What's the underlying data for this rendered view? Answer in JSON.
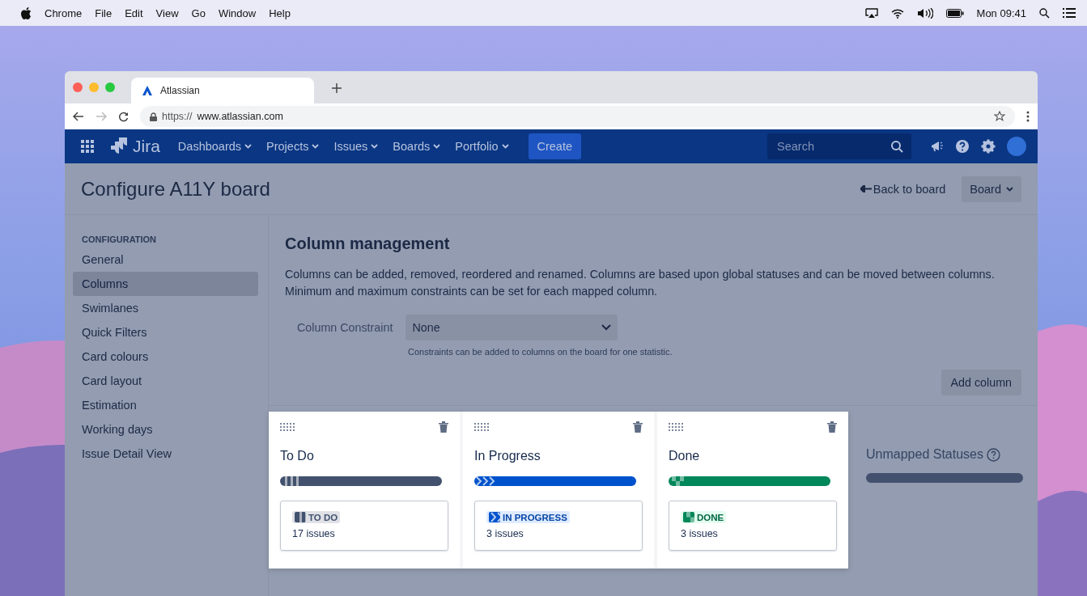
{
  "menubar": {
    "app": "Chrome",
    "menus": [
      "File",
      "Edit",
      "View",
      "Go",
      "Window",
      "Help"
    ],
    "clock": "Mon 09:41"
  },
  "browser": {
    "tab": "Atlassian",
    "url_scheme": "https://",
    "url_host": "www.atlassian.com"
  },
  "nav": {
    "product": "Jira",
    "menus": [
      "Dashboards",
      "Projects",
      "Issues",
      "Boards",
      "Portfolio"
    ],
    "create": "Create",
    "search": {
      "placeholder": "Search"
    }
  },
  "header": {
    "title": "Configure A11Y board",
    "back": "Back to board",
    "board_menu": "Board"
  },
  "sidebar": {
    "heading": "CONFIGURATION",
    "items": [
      {
        "label": "General",
        "selected": false
      },
      {
        "label": "Columns",
        "selected": true
      },
      {
        "label": "Swimlanes",
        "selected": false
      },
      {
        "label": "Quick Filters",
        "selected": false
      },
      {
        "label": "Card colours",
        "selected": false
      },
      {
        "label": "Card layout",
        "selected": false
      },
      {
        "label": "Estimation",
        "selected": false
      },
      {
        "label": "Working days",
        "selected": false
      },
      {
        "label": "Issue Detail View",
        "selected": false
      }
    ]
  },
  "section": {
    "title": "Column management",
    "description": "Columns can be added, removed, reordered and renamed. Columns are based upon global statuses and can be moved between columns. Minimum and maximum constraints can be set for each mapped column.",
    "constraint_label": "Column Constraint",
    "constraint_value": "None",
    "constraint_hint": "Constraints can be added to columns on the board for one statistic.",
    "add_column": "Add column"
  },
  "columns": [
    {
      "name": "To Do",
      "kind": "todo",
      "status": "TO DO",
      "count": "17 issues"
    },
    {
      "name": "In Progress",
      "kind": "inprogress",
      "status": "IN PROGRESS",
      "count": "3 issues"
    },
    {
      "name": "Done",
      "kind": "done",
      "status": "DONE",
      "count": "3 issues"
    }
  ],
  "unmapped": {
    "title": "Unmapped Statuses"
  }
}
